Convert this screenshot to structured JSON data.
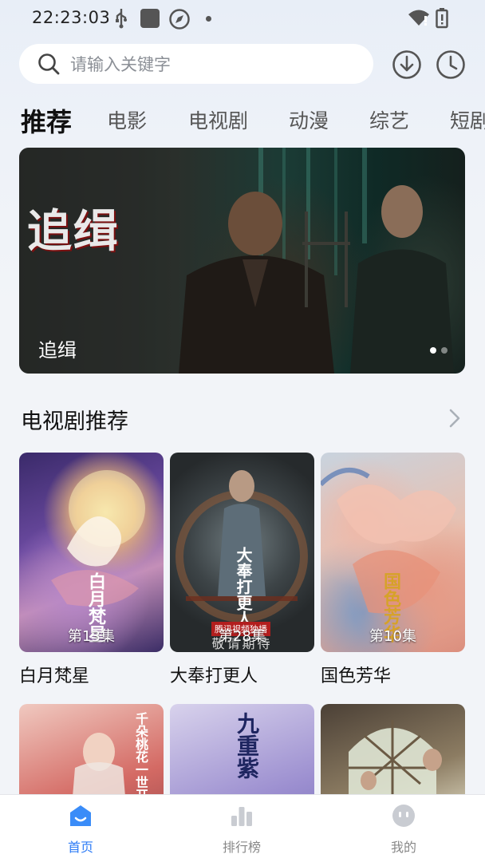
{
  "status_bar": {
    "time": "22:23:03"
  },
  "search": {
    "placeholder": "请输入关键字"
  },
  "tabs": [
    {
      "label": "推荐",
      "active": true
    },
    {
      "label": "电影"
    },
    {
      "label": "电视剧"
    },
    {
      "label": "动漫"
    },
    {
      "label": "综艺"
    },
    {
      "label": "短剧"
    }
  ],
  "banner": {
    "logo_text": "追缉",
    "caption": "追缉",
    "page_count": 2,
    "current_page": 1
  },
  "section": {
    "title": "电视剧推荐"
  },
  "cards": [
    {
      "title": "白月梵星",
      "episode": "第13集",
      "poster_text": "白月梵星"
    },
    {
      "title": "大奉打更人",
      "episode": "第28集",
      "poster_text": "大奉打更人",
      "poster_overlay": "敬请期待",
      "poster_tag": "腾讯视频独播"
    },
    {
      "title": "国色芳华",
      "episode": "第10集",
      "poster_text": "国色芳华"
    },
    {
      "title": "",
      "poster_text": "千朵桃花一世开"
    },
    {
      "title": "",
      "poster_text": "九重紫"
    },
    {
      "title": ""
    }
  ],
  "bottom_nav": [
    {
      "label": "首页",
      "icon": "home-icon",
      "active": true
    },
    {
      "label": "排行榜",
      "icon": "ranking-icon"
    },
    {
      "label": "我的",
      "icon": "profile-icon"
    }
  ],
  "colors": {
    "accent": "#2e7cf6",
    "background": "#f2f4f8"
  }
}
